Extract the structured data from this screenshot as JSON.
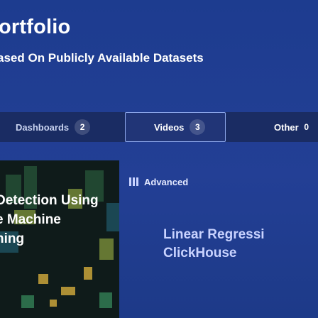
{
  "header": {
    "title": "ortfolio",
    "subtitle": "ased On Publicly Available Datasets"
  },
  "tabs": [
    {
      "label": "Dashboards",
      "count": "2"
    },
    {
      "label": "Videos",
      "count": "3"
    },
    {
      "label": "Other",
      "count": "0"
    }
  ],
  "card_left": {
    "line1": "Detection Using",
    "line2": "e Machine",
    "line3": "ning"
  },
  "card_right": {
    "badge": "Advanced",
    "title_line1": "Linear Regressi",
    "title_line2": "ClickHouse"
  },
  "colors": {
    "background": "#1d3c8f",
    "tab_bar": "#1a2c63",
    "active_tab_border": "#8aa4e8",
    "card_image_bg": "#0f1b1a"
  }
}
